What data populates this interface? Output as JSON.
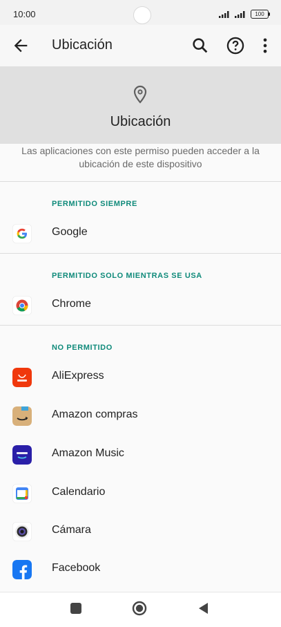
{
  "status_bar": {
    "time": "10:00",
    "battery": "100"
  },
  "app_bar": {
    "title": "Ubicación"
  },
  "header": {
    "title": "Ubicación",
    "description": "Las aplicaciones con este permiso pueden acceder a la ubicación de este dispositivo"
  },
  "sections": [
    {
      "label": "PERMITIDO SIEMPRE",
      "apps": [
        "Google"
      ]
    },
    {
      "label": "PERMITIDO SOLO MIENTRAS SE USA",
      "apps": [
        "Chrome"
      ]
    },
    {
      "label": "NO PERMITIDO",
      "apps": [
        "AliExpress",
        "Amazon compras",
        "Amazon Music",
        "Calendario",
        "Cámara",
        "Facebook"
      ]
    }
  ],
  "icons": {
    "back": "arrow-left-icon",
    "search": "search-icon",
    "help": "help-icon",
    "more": "more-vert-icon",
    "location": "location-pin-icon"
  },
  "colors": {
    "accent": "#0f8a7a",
    "header_bg": "#e0e0e0"
  }
}
